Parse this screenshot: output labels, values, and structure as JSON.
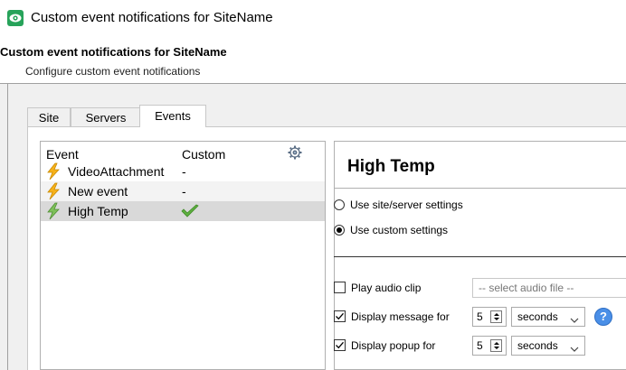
{
  "window": {
    "title": "Custom event notifications for SiteName",
    "accent": "#27a35a"
  },
  "header": {
    "title": "Custom event notifications for SiteName",
    "subtitle": "Configure custom event notifications"
  },
  "tabs": [
    {
      "label": "Site",
      "active": false
    },
    {
      "label": "Servers",
      "active": false
    },
    {
      "label": "Events",
      "active": true
    }
  ],
  "events_list": {
    "columns": {
      "event": "Event",
      "custom": "Custom"
    },
    "settings_icon": "gear-icon",
    "rows": [
      {
        "name": "VideoAttachment",
        "custom": "-",
        "icon": "lightning-bolt-icon"
      },
      {
        "name": "New event",
        "custom": "-",
        "icon": "lightning-bolt-icon"
      },
      {
        "name": "High Temp",
        "custom": "",
        "custom_icon": "green-check-icon",
        "icon": "lightning-bolt-icon",
        "selected": true
      }
    ]
  },
  "detail": {
    "title": "High Temp",
    "radio_site": "Use site/server settings",
    "radio_custom": "Use custom settings",
    "selected_radio": "custom",
    "play_audio": {
      "label": "Play audio clip",
      "checked": false,
      "placeholder": "-- select audio file --"
    },
    "display_message": {
      "label": "Display message for",
      "checked": true,
      "value": "5",
      "unit": "seconds"
    },
    "display_popup": {
      "label": "Display popup for",
      "checked": true,
      "value": "5",
      "unit": "seconds"
    },
    "help_glyph": "?"
  }
}
